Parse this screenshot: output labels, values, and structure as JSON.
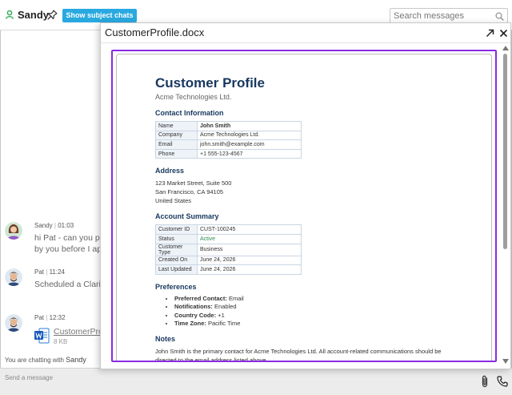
{
  "header": {
    "user_name": "Sandy",
    "subject_chats_label": "Show subject chats",
    "search_placeholder": "Search messages"
  },
  "messages": [
    {
      "author": "Sandy",
      "time": "01:03",
      "lines": [
        "hi Pat - can you pl",
        "by you before I ap"
      ]
    },
    {
      "author": "Pat",
      "time": "11:24",
      "lines": [
        "Scheduled a Clari"
      ]
    },
    {
      "author": "Pat",
      "time": "12:32",
      "attachment": {
        "name": "CustomerPro",
        "size": "8 KB"
      }
    }
  ],
  "footer": {
    "chatting_prefix": "You are chatting with",
    "chatting_with": "Sandy",
    "composer_placeholder": "Send a message"
  },
  "viewer": {
    "title": "CustomerProfile.docx"
  },
  "document": {
    "title": "Customer Profile",
    "subtitle": "Acme Technologies Ltd.",
    "contact": {
      "heading": "Contact Information",
      "rows": [
        {
          "k": "Name",
          "v": "John Smith"
        },
        {
          "k": "Company",
          "v": "Acme Technologies Ltd."
        },
        {
          "k": "Email",
          "v": "john.smith@example.com"
        },
        {
          "k": "Phone",
          "v": "+1 555-123-4567"
        }
      ]
    },
    "address": {
      "heading": "Address",
      "lines": [
        "123 Market Street, Suite 500",
        "San Francisco, CA 94105",
        "United States"
      ]
    },
    "account": {
      "heading": "Account Summary",
      "rows": [
        {
          "k": "Customer ID",
          "v": "CUST-100245"
        },
        {
          "k": "Status",
          "v": "Active"
        },
        {
          "k": "Customer Type",
          "v": "Business"
        },
        {
          "k": "Created On",
          "v": "June 24, 2026"
        },
        {
          "k": "Last Updated",
          "v": "June 24, 2026"
        }
      ]
    },
    "preferences": {
      "heading": "Preferences",
      "items": [
        {
          "label": "Preferred Contact:",
          "value": "Email"
        },
        {
          "label": "Notifications:",
          "value": "Enabled"
        },
        {
          "label": "Country Code:",
          "value": "+1"
        },
        {
          "label": "Time Zone:",
          "value": "Pacific Time"
        }
      ]
    },
    "notes": {
      "heading": "Notes",
      "text": "John Smith is the primary contact for Acme Technologies Ltd. All account-related communications should be directed to the email address listed above."
    }
  },
  "colors": {
    "accent": "#29a9e0",
    "doc_heading": "#17375e",
    "selection_border": "#8a2be2",
    "status_active": "#2e8b57"
  }
}
